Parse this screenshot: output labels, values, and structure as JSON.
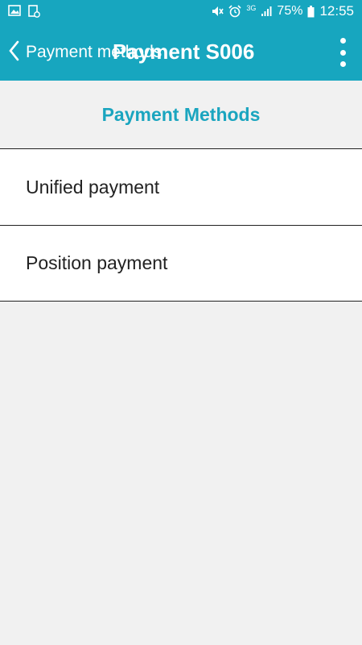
{
  "status_bar": {
    "battery_percent": "75%",
    "time": "12:55",
    "network": "3G",
    "icons": [
      "gallery-icon",
      "screenshot-icon",
      "mute-icon",
      "alarm-icon",
      "network-3g-icon",
      "signal-icon",
      "battery-icon"
    ]
  },
  "app_bar": {
    "back_label": "Payment methods",
    "title": "Payment S006",
    "icons": [
      "chevron-left-icon",
      "more-vertical-icon"
    ]
  },
  "section": {
    "title": "Payment Methods"
  },
  "payment_methods": [
    {
      "label": "Unified payment"
    },
    {
      "label": "Position payment"
    }
  ],
  "colors": {
    "app_bar": "#17a6bf",
    "accent_text": "#1aa5bf",
    "background": "#f1f1f1",
    "list_background": "#ffffff"
  }
}
